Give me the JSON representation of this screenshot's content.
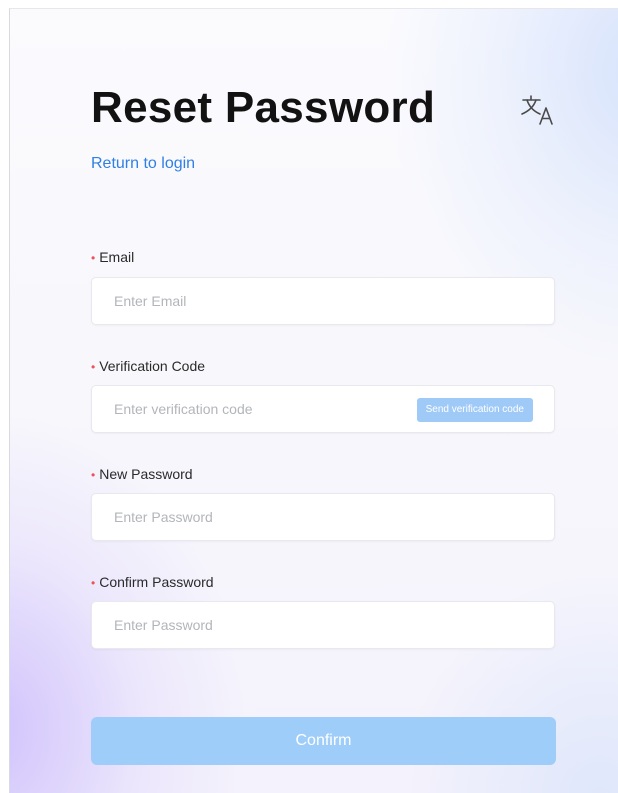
{
  "header": {
    "title": "Reset Password",
    "return_link": "Return to login",
    "language_icon": "translate-icon"
  },
  "form": {
    "required_marker": "•",
    "email": {
      "label": "Email",
      "placeholder": "Enter Email",
      "value": ""
    },
    "verification_code": {
      "label": "Verification Code",
      "placeholder": "Enter verification code",
      "value": "",
      "send_button": "Send verification code"
    },
    "new_password": {
      "label": "New Password",
      "placeholder": "Enter Password",
      "value": ""
    },
    "confirm_password": {
      "label": "Confirm Password",
      "placeholder": "Enter Password",
      "value": ""
    },
    "confirm_button": "Confirm"
  },
  "colors": {
    "link": "#2f7fe4",
    "required": "#f0505a",
    "button_disabled": "#9ecdfa",
    "send_button": "#9fcaf8"
  }
}
